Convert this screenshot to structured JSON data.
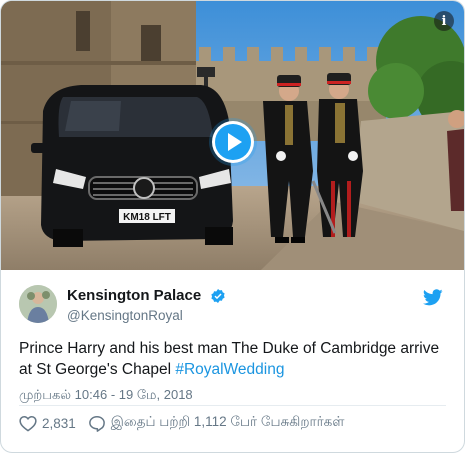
{
  "media": {
    "plate_text": "KM18 LFT",
    "info_glyph": "i",
    "play_icon": "play-icon"
  },
  "account": {
    "display_name": "Kensington Palace",
    "handle": "@KensingtonRoyal",
    "verified_icon": "verified-badge-icon",
    "platform_icon": "twitter-bird-icon"
  },
  "tweet": {
    "text": "Prince Harry and his best man The Duke of Cambridge arrive at St George's Chapel ",
    "hashtag": "#RoyalWedding",
    "timestamp": "முற்பகல் 10:46 - 19 மே, 2018"
  },
  "actions": {
    "likes": "2,831",
    "reply_label": "இதைப் பற்றி 1,112 பேர் பேசுகிறார்கள்"
  },
  "colors": {
    "accent": "#1da1f2",
    "link": "#1b95e0",
    "muted": "#657786",
    "text": "#14171a"
  }
}
